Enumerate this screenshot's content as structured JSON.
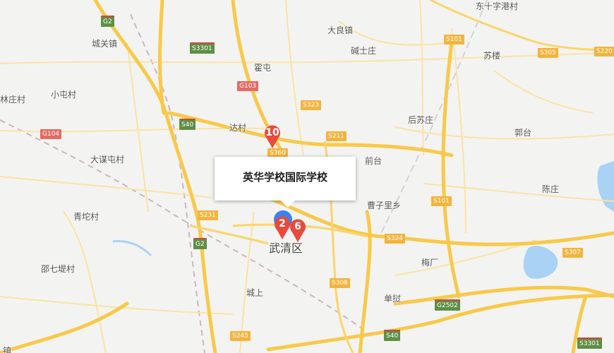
{
  "colors": {
    "highway": "#f8c94a",
    "road_minor": "#fbe3a4",
    "water": "#a9d2f5",
    "rail": "#c9b7c2",
    "pin_red": "#e84a3c",
    "pin_blue": "#3b82f0"
  },
  "places": {
    "dongshizigangcun": "东十字港村",
    "daliangzhen": "大良镇",
    "chengguanzhen": "城关镇",
    "jianshizhuang": "碱士庄",
    "sulou": "苏楼",
    "huotun": "霍屯",
    "xiaotuncun": "小屯村",
    "linzhuangcun": "林庄村",
    "houzhuang": "后苏庄",
    "dacun": "达村",
    "guotai": "郭台",
    "qiantai": "前台",
    "damoutuncun": "大谋屯村",
    "chenzhuang": "陈庄",
    "caozilixiang": "曹子里乡",
    "qingtuocun": "青坨村",
    "meichang": "梅厂",
    "shaoqidicun": "邵七堤村",
    "chengshang": "城上",
    "danji": "单挝",
    "zhen": "镇"
  },
  "district": "武清区",
  "routes": {
    "g2_top": "G2",
    "g2_mid": "G2",
    "s3301_top": "S3301",
    "s3301_bottom": "S3301",
    "g103": "G103",
    "g104": "G104",
    "s101_top": "S101",
    "s101_mid": "S101",
    "s305": "S305",
    "s220": "S220",
    "s323": "S323",
    "s40_top": "S40",
    "s40_bottom": "S40",
    "s211": "S211",
    "s360": "S360",
    "s231": "S231",
    "s324": "S324",
    "s307": "S307",
    "s308": "S308",
    "g2502": "G2502",
    "s245": "S245"
  },
  "markers": {
    "m10": "10",
    "m2": "2",
    "m6": "6"
  },
  "popup": {
    "title": "英华学校国际学校"
  }
}
